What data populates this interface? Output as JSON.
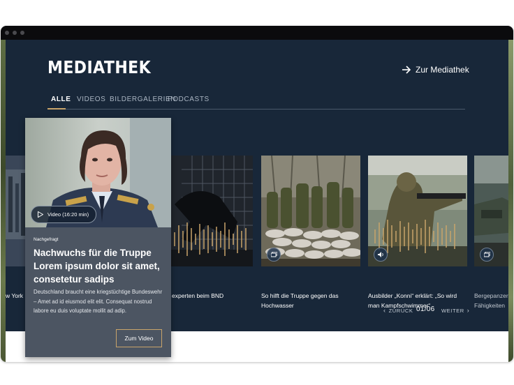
{
  "page": {
    "title": "MEDIATHEK",
    "link_label": "Zur Mediathek"
  },
  "tabs": [
    "ALLE",
    "VIDEOS",
    "BILDERGALERIEN",
    "PODCASTS"
  ],
  "featured": {
    "badge": "Video (16:20 min)",
    "kicker": "Nachgefragt",
    "headline": "Nachwuchs für die Truppe Lorem ipsum dolor sit amet, consetetur sadips",
    "body": "Deutschland braucht eine kriegstüchtige Bundeswehr – Amet ad id eiusmod elit elit. Consequat nostrud labore eu duis voluptate mollit ad adip.",
    "button": "Zum Video"
  },
  "cards": [
    {
      "title_1": "experten beim BND",
      "title_2": "",
      "icon": "gallery-icon"
    },
    {
      "title_1": "So hilft die Truppe gegen das",
      "title_2": "Hochwasser",
      "icon": "gallery-icon"
    },
    {
      "title_1": "Ausbilder „Konni“ erklärt: „So wird",
      "title_2": "man Kampfschwimmer“",
      "icon": "speaker-icon"
    },
    {
      "title_1": "Bergepanzer",
      "title_2": "Fähigkeiten",
      "icon": "gallery-icon"
    }
  ],
  "left_partial": {
    "line_1": "",
    "line_2": "w York"
  },
  "pager": {
    "prev": "ZURÜCK",
    "count": "01/06",
    "next": "WEITER"
  },
  "colors": {
    "background": "#182739",
    "accent": "#c9a46a",
    "featured_panel": "#4c5562"
  }
}
